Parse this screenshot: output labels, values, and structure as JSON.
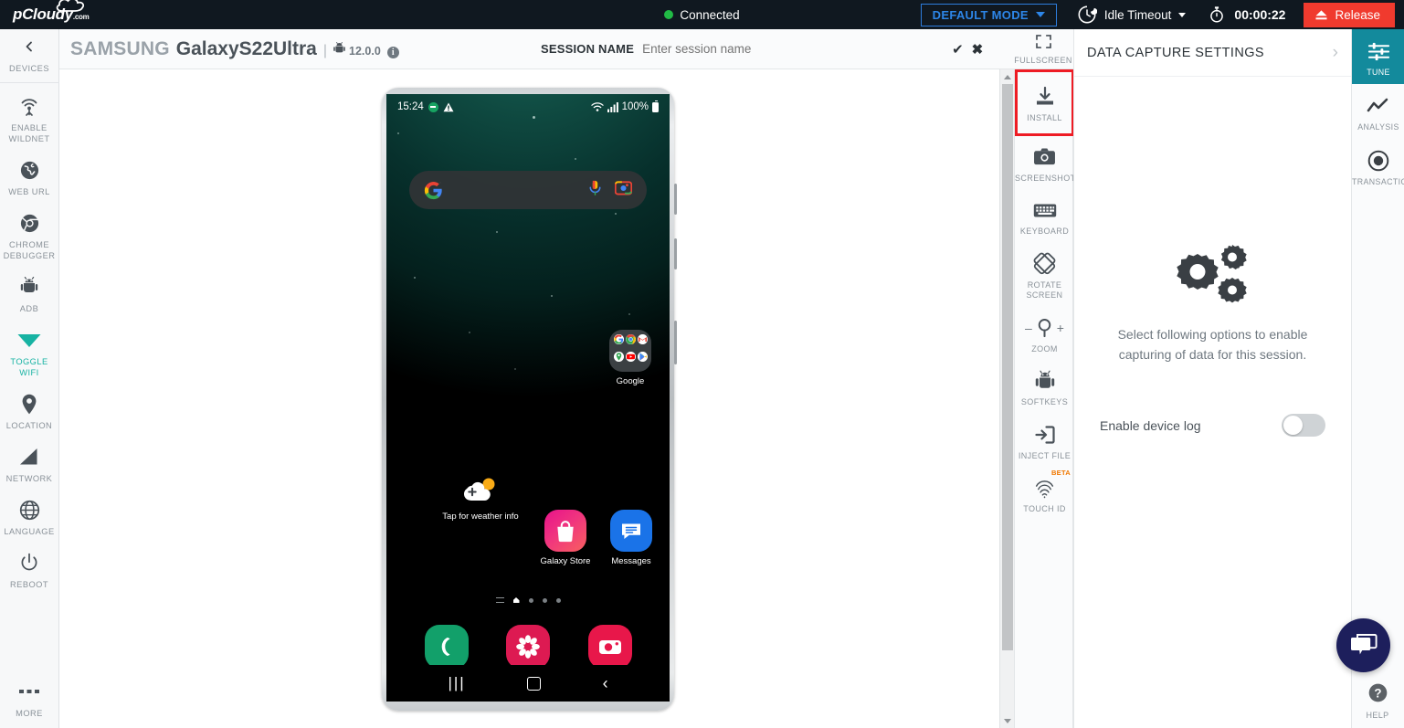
{
  "topbar": {
    "logo": "pCloudy",
    "logo_suffix": ".com",
    "connection_status": "Connected",
    "connection_color": "#21ba45",
    "mode_button": "DEFAULT MODE",
    "idle_timeout": "Idle Timeout",
    "timer": "00:00:22",
    "release_button": "Release",
    "release_color": "#f03a2e"
  },
  "sidebar": {
    "collapse_label": "DEVICES",
    "items": [
      {
        "label": "ENABLE WILDNET",
        "icon": "wildnet-icon",
        "active": false
      },
      {
        "label": "WEB URL",
        "icon": "globe-icon",
        "active": false
      },
      {
        "label": "CHROME DEBUGGER",
        "icon": "chrome-icon",
        "active": false
      },
      {
        "label": "ADB",
        "icon": "android-bug-icon",
        "active": false
      },
      {
        "label": "TOGGLE WIFI",
        "icon": "wifi-icon",
        "active": true
      },
      {
        "label": "LOCATION",
        "icon": "map-pin-icon",
        "active": false
      },
      {
        "label": "NETWORK",
        "icon": "signal-bars-icon",
        "active": false
      },
      {
        "label": "LANGUAGE",
        "icon": "language-globe-icon",
        "active": false
      },
      {
        "label": "REBOOT",
        "icon": "power-icon",
        "active": false
      }
    ],
    "more_label": "MORE",
    "active_color": "#17b3a3"
  },
  "device_header": {
    "brand": "SAMSUNG",
    "model": "GalaxyS22Ultra",
    "separator": "|",
    "os_version": "12.0.0",
    "session_label": "SESSION NAME",
    "session_value": "",
    "session_placeholder": "Enter session name",
    "confirm_icon": "check-icon",
    "cancel_icon": "close-icon",
    "fullscreen_label": "FULLSCREEN"
  },
  "device_screen": {
    "status_bar": {
      "time": "15:24",
      "battery_percent": "100%"
    },
    "search_bar_hint": "",
    "folder": {
      "label": "Google",
      "apps": [
        "Search",
        "Chrome",
        "Gmail",
        "Maps",
        "YouTube",
        "Play Store"
      ]
    },
    "weather_widget_label": "Tap for weather info",
    "home_apps": [
      {
        "label": "Galaxy Store",
        "icon": "shopping-bag-icon"
      },
      {
        "label": "Messages",
        "icon": "message-bubble-icon"
      }
    ],
    "dock_apps": [
      {
        "label": "Phone",
        "icon": "phone-icon"
      },
      {
        "label": "Gallery",
        "icon": "flower-icon"
      },
      {
        "label": "Camera",
        "icon": "camera-icon"
      }
    ],
    "page_count": 4,
    "active_page": 1,
    "nav": {
      "recents": "|||",
      "home": "home-square-icon",
      "back": "back-chevron-icon"
    }
  },
  "tool_rail": {
    "items": [
      {
        "label": "INSTALL",
        "icon": "download-install-icon",
        "highlighted": true
      },
      {
        "label": "SCREENSHOT",
        "icon": "camera-icon",
        "highlighted": false
      },
      {
        "label": "KEYBOARD",
        "icon": "keyboard-icon",
        "highlighted": false
      },
      {
        "label": "ROTATE SCREEN",
        "icon": "rotate-screen-icon",
        "highlighted": false
      },
      {
        "label": "ZOOM",
        "icon": "magnifier-icon",
        "highlighted": false
      },
      {
        "label": "SOFTKEYS",
        "icon": "android-icon",
        "highlighted": false
      },
      {
        "label": "INJECT FILE",
        "icon": "inject-file-icon",
        "highlighted": false
      },
      {
        "label": "TOUCH ID",
        "icon": "fingerprint-icon",
        "highlighted": false,
        "badge": "BETA"
      }
    ],
    "zoom_minus": "–",
    "zoom_plus": "+",
    "highlight_color": "#ee1c24",
    "badge_color": "#f07800"
  },
  "right_panel": {
    "title": "DATA CAPTURE SETTINGS",
    "collapse_icon": "chevron-right-icon",
    "empty_icon": "gears-icon",
    "message": "Select following options to enable capturing of data for this session.",
    "toggle_label": "Enable device log",
    "toggle_on": false
  },
  "far_rail": {
    "items": [
      {
        "label": "TUNE",
        "icon": "sliders-icon",
        "active": true
      },
      {
        "label": "ANALYSIS",
        "icon": "line-chart-icon",
        "active": false
      },
      {
        "label": "TRANSACTION",
        "icon": "record-dot-icon",
        "active": false
      }
    ],
    "active_color": "#138a9c",
    "chat_icon": "chat-bubble-icon",
    "help_label": "HELP",
    "help_icon": "question-mark-icon"
  }
}
